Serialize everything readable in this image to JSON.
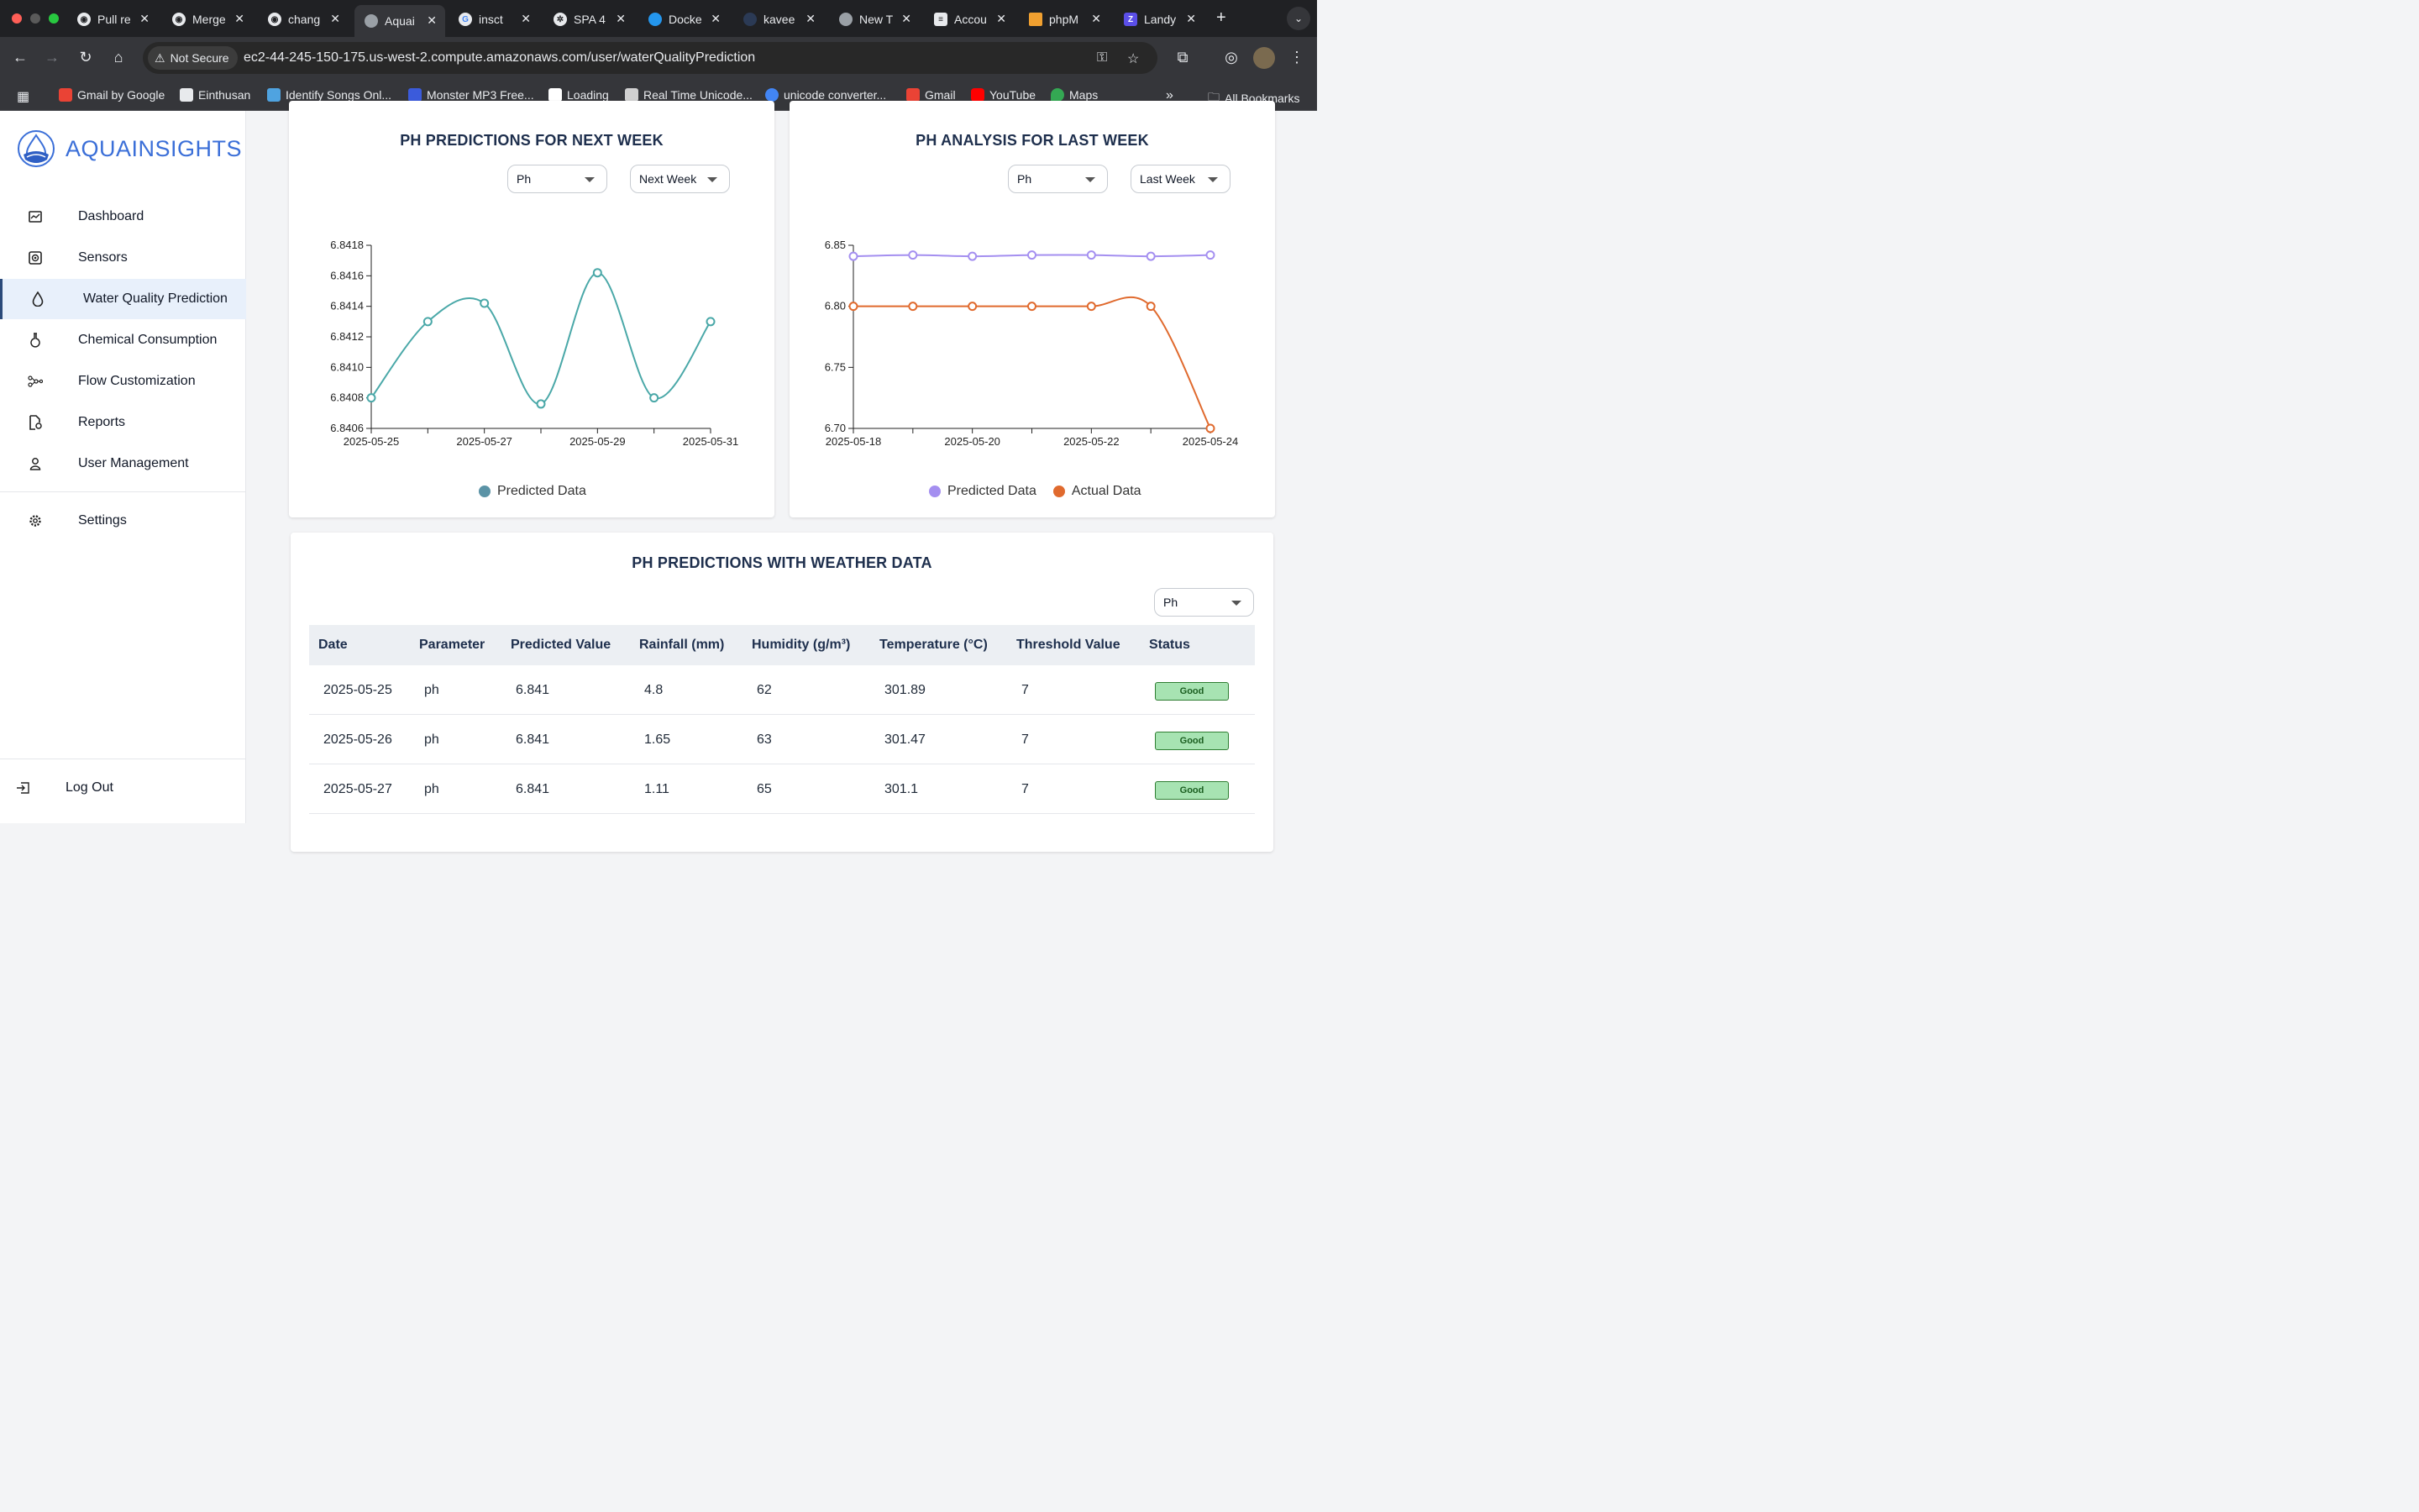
{
  "browser": {
    "tabs": [
      {
        "title": "Pull re",
        "icon": "github-icon"
      },
      {
        "title": "Merge",
        "icon": "merge-icon"
      },
      {
        "title": "chang",
        "icon": "github-icon"
      },
      {
        "title": "Aquai",
        "icon": "globe-icon",
        "active": true
      },
      {
        "title": "insct",
        "icon": "google-icon"
      },
      {
        "title": "SPA 4",
        "icon": "openai-icon"
      },
      {
        "title": "Docke",
        "icon": "docker-icon"
      },
      {
        "title": "kavee",
        "icon": "app-icon"
      },
      {
        "title": "New T",
        "icon": "chrome-icon"
      },
      {
        "title": "Accou",
        "icon": "database-icon"
      },
      {
        "title": "phpM",
        "icon": "phpmyadmin-icon"
      },
      {
        "title": "Landy",
        "icon": "z-icon"
      }
    ],
    "security_label": "Not Secure",
    "url": "ec2-44-245-150-175.us-west-2.compute.amazonaws.com/user/waterQualityPrediction",
    "bookmarks": [
      {
        "label": "Gmail by Google",
        "color": "#ea4335"
      },
      {
        "label": "Einthusan",
        "color": "#e8eaed"
      },
      {
        "label": "Identify Songs Onl...",
        "color": "#4fa3e0"
      },
      {
        "label": "Monster MP3 Free...",
        "color": "#3b5bdb"
      },
      {
        "label": "Loading",
        "color": "#ffffff"
      },
      {
        "label": "Real Time Unicode...",
        "color": "#d0d0d0"
      },
      {
        "label": "unicode converter...",
        "color": "#4285f4"
      },
      {
        "label": "Gmail",
        "color": "#ea4335"
      },
      {
        "label": "YouTube",
        "color": "#ff0000"
      },
      {
        "label": "Maps",
        "color": "#34a853"
      }
    ],
    "all_bookmarks": "All Bookmarks"
  },
  "sidebar": {
    "logo": "AQUAINSIGHTS",
    "items": [
      {
        "label": "Dashboard",
        "icon": "dashboard-icon"
      },
      {
        "label": "Sensors",
        "icon": "sensor-icon"
      },
      {
        "label": "Water Quality Prediction",
        "icon": "water-drop-icon",
        "active": true
      },
      {
        "label": "Chemical Consumption",
        "icon": "flask-icon"
      },
      {
        "label": "Flow Customization",
        "icon": "flow-icon"
      },
      {
        "label": "Reports",
        "icon": "report-icon"
      },
      {
        "label": "User Management",
        "icon": "user-icon"
      }
    ],
    "settings": "Settings",
    "logout": "Log Out"
  },
  "next_week_card": {
    "title": "PH PREDICTIONS FOR NEXT WEEK",
    "parameter_select": "Ph",
    "range_select": "Next Week"
  },
  "last_week_card": {
    "title": "PH ANALYSIS FOR LAST WEEK",
    "parameter_select": "Ph",
    "range_select": "Last Week"
  },
  "weather_card": {
    "title": "PH PREDICTIONS WITH WEATHER DATA",
    "parameter_select": "Ph",
    "columns": [
      "Date",
      "Parameter",
      "Predicted Value",
      "Rainfall (mm)",
      "Humidity (g/m³)",
      "Temperature (°C)",
      "Threshold Value",
      "Status"
    ],
    "rows": [
      [
        "2025-05-25",
        "ph",
        "6.841",
        "4.8",
        "62",
        "301.89",
        "7",
        "Good"
      ],
      [
        "2025-05-26",
        "ph",
        "6.841",
        "1.65",
        "63",
        "301.47",
        "7",
        "Good"
      ],
      [
        "2025-05-27",
        "ph",
        "6.841",
        "1.11",
        "65",
        "301.1",
        "7",
        "Good"
      ]
    ]
  },
  "chart_data": [
    {
      "type": "line",
      "title": "PH PREDICTIONS FOR NEXT WEEK",
      "x": [
        "2025-05-25",
        "2025-05-26",
        "2025-05-27",
        "2025-05-28",
        "2025-05-29",
        "2025-05-30",
        "2025-05-31"
      ],
      "x_tick_labels": [
        "2025-05-25",
        "2025-05-27",
        "2025-05-29",
        "2025-05-31"
      ],
      "ylim": [
        6.8406,
        6.8418
      ],
      "y_ticks": [
        "6.8406",
        "6.8408",
        "6.8410",
        "6.8412",
        "6.8414",
        "6.8416",
        "6.8418"
      ],
      "series": [
        {
          "name": "Predicted Data",
          "color": "#4aa8a8",
          "values": [
            6.8408,
            6.8413,
            6.84142,
            6.84076,
            6.84162,
            6.8408,
            6.8413
          ]
        }
      ],
      "legend": "bottom"
    },
    {
      "type": "line",
      "title": "PH ANALYSIS FOR LAST WEEK",
      "x": [
        "2025-05-18",
        "2025-05-19",
        "2025-05-20",
        "2025-05-21",
        "2025-05-22",
        "2025-05-23",
        "2025-05-24"
      ],
      "x_tick_labels": [
        "2025-05-18",
        "2025-05-20",
        "2025-05-22",
        "2025-05-24"
      ],
      "ylim": [
        6.7,
        6.85
      ],
      "y_ticks": [
        "6.70",
        "6.75",
        "6.80",
        "6.85"
      ],
      "series": [
        {
          "name": "Predicted Data",
          "color": "#a48ff0",
          "values": [
            6.841,
            6.842,
            6.841,
            6.842,
            6.842,
            6.841,
            6.842
          ]
        },
        {
          "name": "Actual Data",
          "color": "#e06a2e",
          "values": [
            6.8,
            6.8,
            6.8,
            6.8,
            6.8,
            6.8,
            6.7
          ]
        }
      ],
      "legend": "bottom"
    }
  ]
}
